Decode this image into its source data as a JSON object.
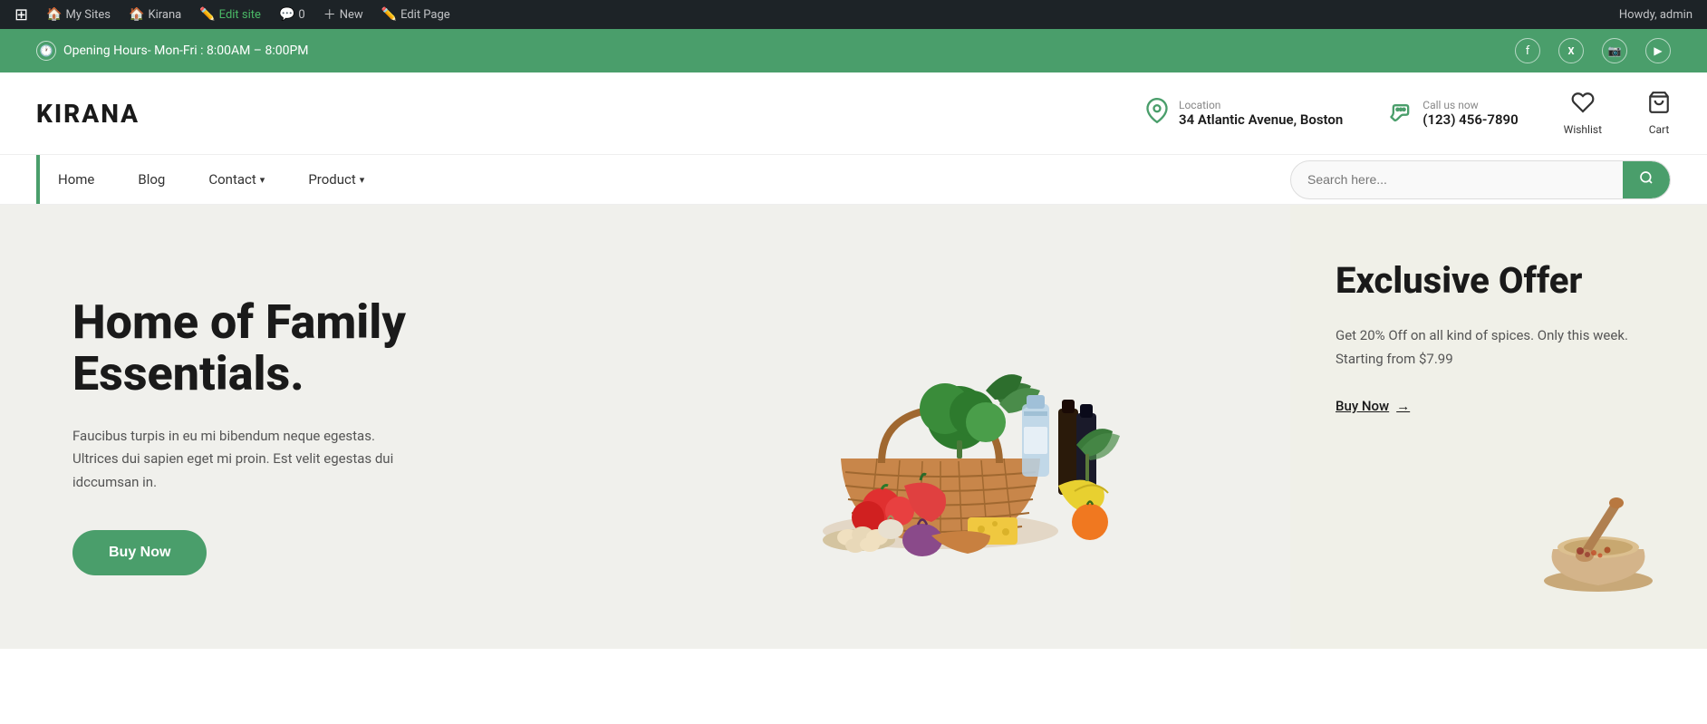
{
  "admin_bar": {
    "wordpress_icon": "⊞",
    "my_sites_label": "My Sites",
    "kirana_label": "Kirana",
    "edit_site_label": "Edit site",
    "comments_count": "0",
    "new_label": "New",
    "edit_page_label": "Edit Page"
  },
  "top_bar": {
    "opening_hours": "Opening Hours- Mon-Fri : 8:00AM – 8:00PM",
    "social_icons": [
      "f",
      "𝕏",
      "📷",
      "▶"
    ]
  },
  "header": {
    "logo": "KIRANA",
    "location_label": "Location",
    "location_value": "34 Atlantic Avenue, Boston",
    "call_label": "Call us now",
    "call_value": "(123) 456-7890",
    "wishlist_label": "Wishlist",
    "cart_label": "Cart"
  },
  "nav": {
    "items": [
      {
        "label": "Home",
        "active": true,
        "has_dropdown": false
      },
      {
        "label": "Blog",
        "active": false,
        "has_dropdown": false
      },
      {
        "label": "Contact",
        "active": false,
        "has_dropdown": true
      },
      {
        "label": "Product",
        "active": false,
        "has_dropdown": true
      }
    ],
    "search_placeholder": "Search here..."
  },
  "hero": {
    "title": "Home of Family Essentials.",
    "description": "Faucibus turpis in eu mi bibendum neque egestas. Ultrices dui sapien eget mi proin. Est velit egestas dui idccumsan in.",
    "buy_now_label": "Buy Now"
  },
  "exclusive_offer": {
    "title": "Exclusive Offer",
    "description": "Get 20% Off on all kind of spices. Only this week. Starting from $7.99",
    "buy_now_label": "Buy Now",
    "arrow": "→"
  }
}
